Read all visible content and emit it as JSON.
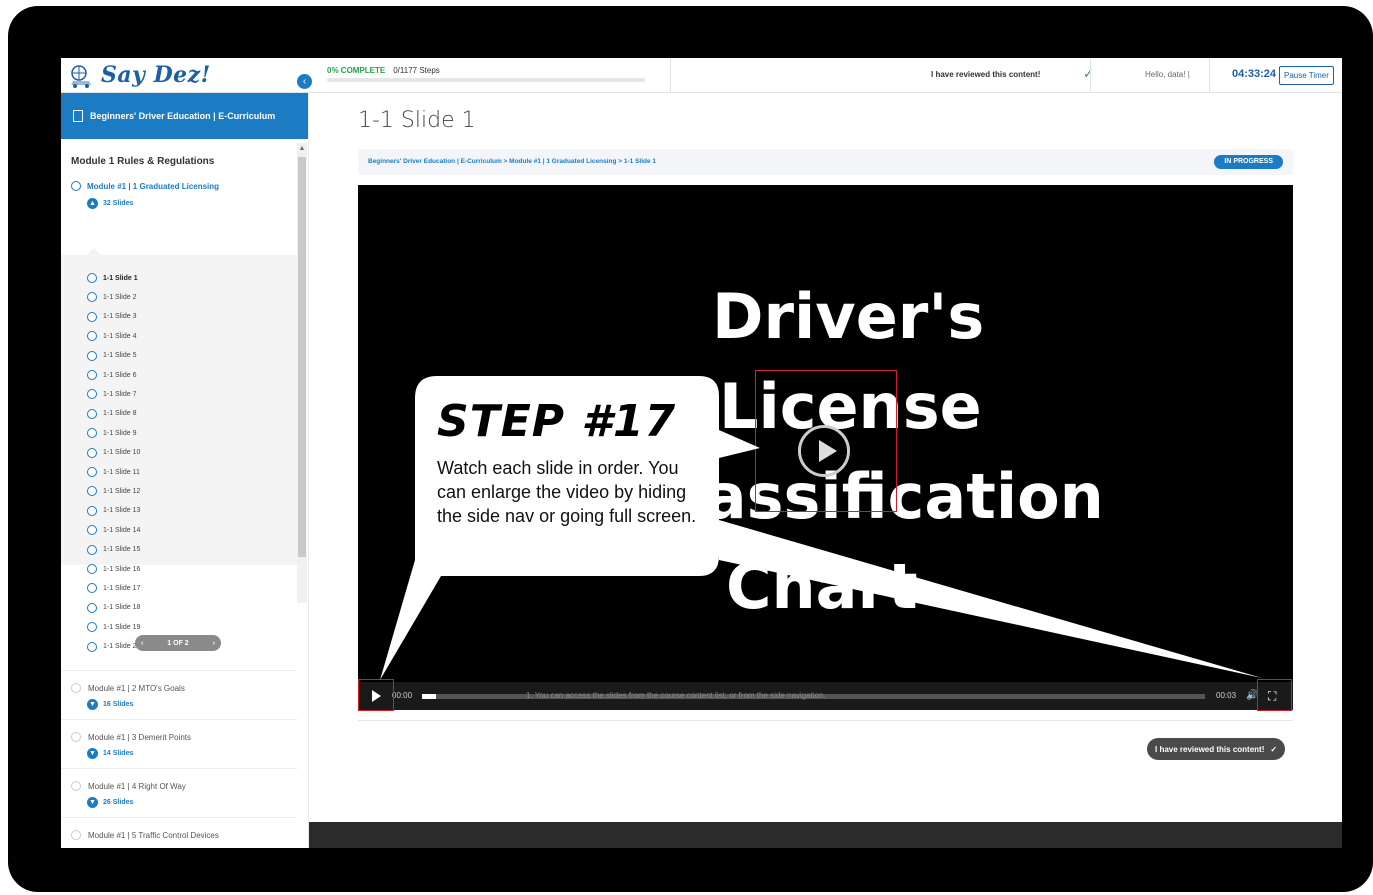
{
  "header": {
    "logo_text": "Say Dez!",
    "progress_percent_label": "0% COMPLETE",
    "steps_label": "0/1177 Steps",
    "progress_fraction": 0,
    "reviewed_label": "I have reviewed this content!",
    "greeting": "Hello, data! |",
    "timer": "04:33:24",
    "pause_label": "Pause Timer"
  },
  "sidebar": {
    "course_title": "Beginners' Driver Education | E-Curriculum",
    "module_title": "Module 1 Rules & Regulations",
    "active_lesson": {
      "label": "Module #1 | 1 Graduated Licensing",
      "count": "32 Slides"
    },
    "slides": [
      "1-1 Slide 1",
      "1-1 Slide 2",
      "1-1 Slide 3",
      "1-1 Slide 4",
      "1-1 Slide 5",
      "1-1 Slide 6",
      "1-1 Slide 7",
      "1-1 Slide 8",
      "1-1 Slide 9",
      "1-1 Slide 10",
      "1-1 Slide 11",
      "1-1 Slide 12",
      "1-1 Slide 13",
      "1-1 Slide 14",
      "1-1 Slide 15",
      "1-1 Slide 16",
      "1-1 Slide 17",
      "1-1 Slide 18",
      "1-1 Slide 19",
      "1-1 Slide 20"
    ],
    "pager": "1 OF 2",
    "lessons": [
      {
        "label": "Module #1 | 2 MTO's Goals",
        "count": "16 Slides"
      },
      {
        "label": "Module #1 | 3 Demerit Points",
        "count": "14 Slides"
      },
      {
        "label": "Module #1 | 4 Right Of Way",
        "count": "26 Slides"
      },
      {
        "label": "Module #1 | 5 Traffic Control Devices",
        "count": ""
      }
    ]
  },
  "main": {
    "page_title": "1-1 Slide 1",
    "breadcrumb": "Beginners' Driver Education | E-Curriculum > Module #1 | 1 Graduated Licensing > 1-1 Slide 1",
    "status": "IN PROGRESS",
    "slide_lines": [
      "Driver's",
      "License",
      "Classification",
      "Chart"
    ],
    "time_start": "00:00",
    "time_end": "00:03",
    "caption": "1.   You can access the slides from the course content list, or from the side navigation.",
    "reviewed_button": "I have reviewed this content!"
  },
  "callout": {
    "title": "STEP #17",
    "text": "Watch each slide in order. You can enlarge the video by hiding the side nav or going full screen."
  },
  "colors": {
    "accent": "#1b7cc4",
    "success": "#2aa14a",
    "highlight": "#d11f2a"
  }
}
